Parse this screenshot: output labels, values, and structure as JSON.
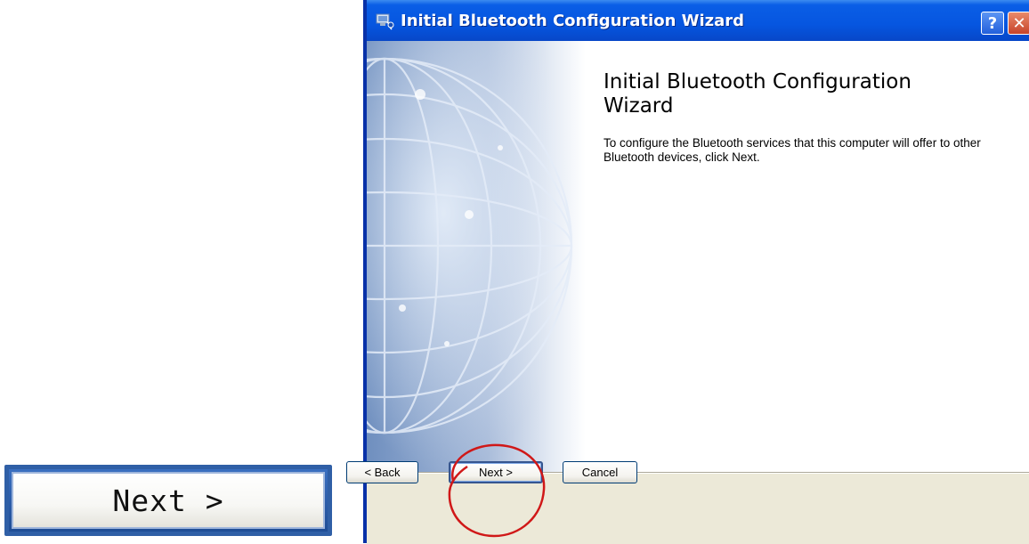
{
  "zoom_callout": {
    "label": "Next >"
  },
  "window": {
    "title": "Initial Bluetooth Configuration Wizard",
    "help_label": "?",
    "close_label": "✕"
  },
  "page": {
    "heading": "Initial Bluetooth Configuration Wizard",
    "description": "To configure the Bluetooth services that this computer will offer to other Bluetooth devices, click Next."
  },
  "buttons": {
    "back": "< Back",
    "next": "Next >",
    "cancel": "Cancel"
  },
  "colors": {
    "titlebar": "#0656e0",
    "button_bar": "#ece9d8",
    "highlight_ring": "#d01818"
  },
  "icons": {
    "window_icon": "bluetooth-wizard-icon",
    "side_art": "globe-illustration"
  }
}
